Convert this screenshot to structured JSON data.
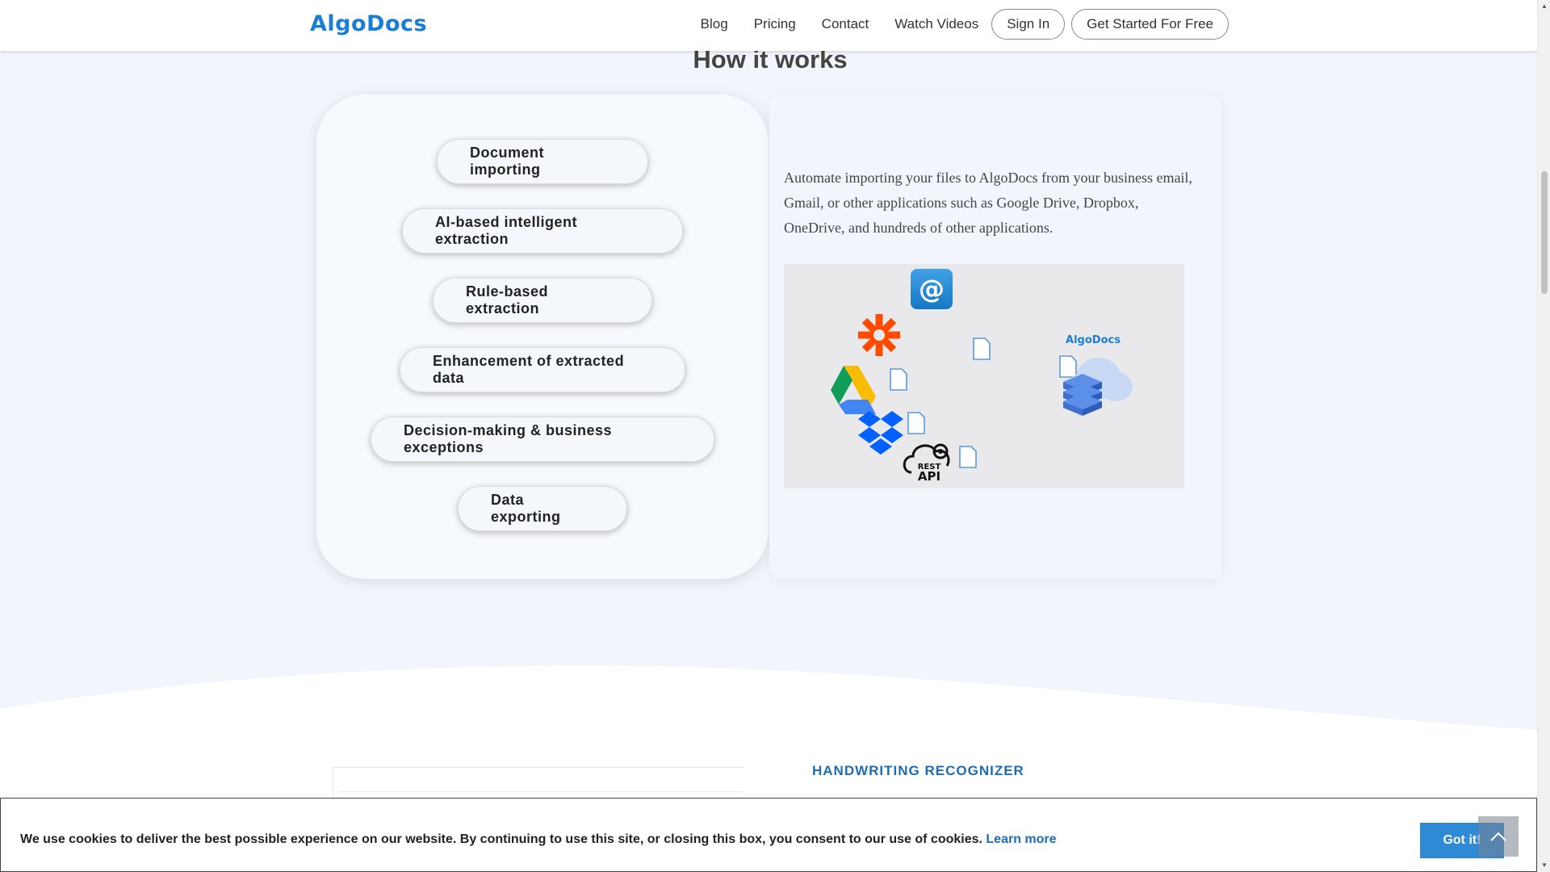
{
  "header": {
    "logo": "AlgoDocs",
    "nav": [
      "Blog",
      "Pricing",
      "Contact",
      "Watch Videos"
    ],
    "sign_in": "Sign In",
    "get_started": "Get Started For Free"
  },
  "section": {
    "title": "How it works",
    "steps": [
      "Document importing",
      "AI-based intelligent extraction",
      "Rule-based extraction",
      "Enhancement of extracted data",
      "Decision-making & business exceptions",
      "Data exporting"
    ],
    "description": "Automate importing your files to AlgoDocs from your business email, Gmail, or other applications such as Google Drive, Dropbox, OneDrive, and hundreds of other applications.",
    "illustration": {
      "email_symbol": "@",
      "api_line1": "REST",
      "api_line2": "API",
      "brand": "AlgoDocs"
    }
  },
  "next_section": {
    "label": "HANDWRITING RECOGNIZER"
  },
  "cookie": {
    "text": "We use cookies to deliver the best possible experience on our website. By continuing to use this site, or closing this box, you consent to our use of cookies.",
    "link": "Learn more",
    "button": "Got it!"
  },
  "colors": {
    "brand": "#1a7fd4",
    "page_bg": "#f2f6fc",
    "accent_button": "#2f8ad6",
    "zapier": "#ff4a00",
    "dropbox": "#0061ff"
  },
  "icons": [
    "email-at-icon",
    "zapier-icon",
    "google-drive-icon",
    "dropbox-icon",
    "rest-api-icon",
    "file-icon",
    "algodocs-cloud-icon",
    "scroll-to-top-icon"
  ]
}
